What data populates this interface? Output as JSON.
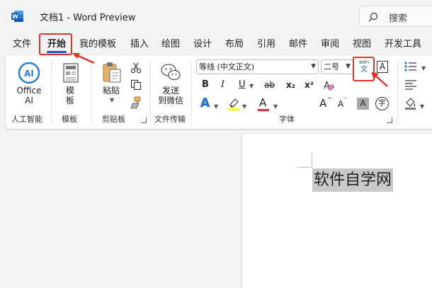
{
  "titlebar": {
    "doc_title": "文档1  -  Word Preview",
    "search_label": "搜索"
  },
  "tabs": [
    {
      "label": "文件"
    },
    {
      "label": "开始"
    },
    {
      "label": "我的模板"
    },
    {
      "label": "插入"
    },
    {
      "label": "绘图"
    },
    {
      "label": "设计"
    },
    {
      "label": "布局"
    },
    {
      "label": "引用"
    },
    {
      "label": "邮件"
    },
    {
      "label": "审阅"
    },
    {
      "label": "视图"
    },
    {
      "label": "开发工具"
    }
  ],
  "ribbon": {
    "office_ai": {
      "line1": "Office",
      "line2": "AI",
      "group": "人工智能"
    },
    "templates": {
      "line1": "模",
      "line2": "板",
      "group": "模板"
    },
    "clipboard": {
      "paste": "粘贴",
      "group": "剪贴板"
    },
    "file_transfer": {
      "line1": "发送",
      "line2": "到微信",
      "group": "文件传输"
    },
    "font": {
      "font_name": "等线 (中文正文)",
      "font_size": "二号",
      "bold": "B",
      "italic": "I",
      "underline": "U",
      "strikethrough": "ab",
      "subscript": "x₂",
      "superscript": "x²",
      "text_effect": "A",
      "font_color": "A",
      "grow": "A",
      "shrink": "A",
      "shading": "A",
      "enclose": "字",
      "phonetic_top": "wén",
      "phonetic_bottom": "文",
      "char_border": "A",
      "group": "字体"
    },
    "colors": {
      "accent": "#185abd",
      "highlight_yellow": "#ffff00",
      "font_red": "#d13438",
      "annotation_red": "#e0322a"
    }
  },
  "document": {
    "text": "软件自学网"
  }
}
